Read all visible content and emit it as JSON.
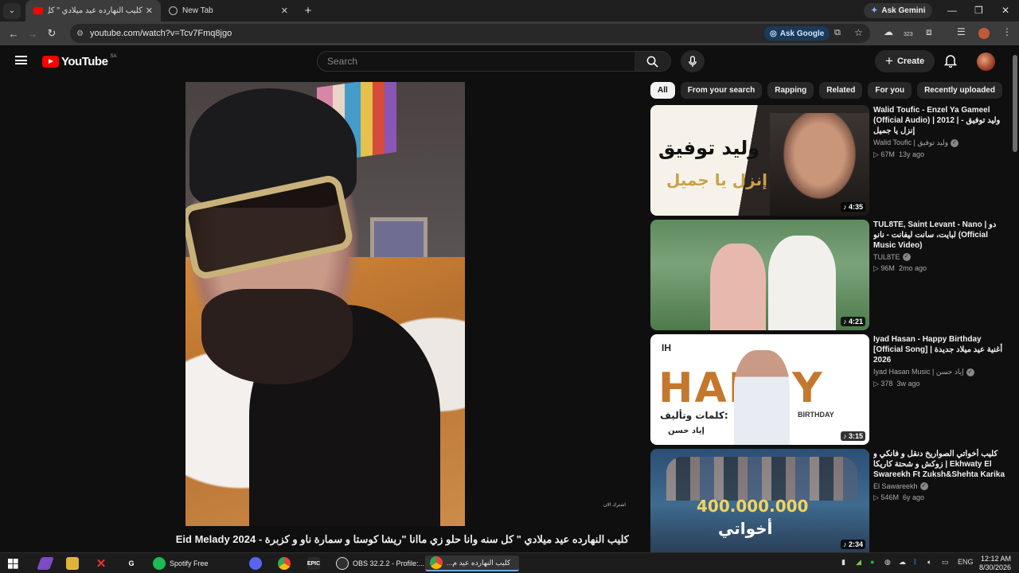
{
  "browser": {
    "tabs": [
      {
        "title": "كليب النهارده عيد ميلادي \" كل سنة",
        "active": true
      },
      {
        "title": "New Tab",
        "active": false
      }
    ],
    "ask_gemini": "Ask Gemini",
    "url": "youtube.com/watch?v=Tcv7Fmq8jgo",
    "ask_google": "Ask Google",
    "badge_count": "323"
  },
  "youtube": {
    "logo": "YouTube",
    "country": "SA",
    "search_placeholder": "Search",
    "create_label": "Create"
  },
  "video": {
    "title": "كليب النهارده عيد ميلادي \" كل سنه وانا حلو زي ماانا \"ريشا كوستا و سمارة ناو و كزبرة - Eid Melady 2024",
    "overlay_caption": "اشترك الان"
  },
  "chips": [
    "All",
    "From your search",
    "Rapping",
    "Related",
    "For you",
    "Recently uploaded"
  ],
  "recommendations": [
    {
      "title": "Walid Toufic - Enzel Ya Gameel (Official Audio) | 2012 | وليد توفيق - إنزل يا جميل",
      "channel": "Walid Toufic | وليد توفيق",
      "verified": true,
      "views": "67M",
      "age": "13y ago",
      "duration": "4:35",
      "thumb_text": [
        "وليد توفيق",
        "إنزل يا جميل"
      ]
    },
    {
      "title": "TUL8TE, Saint Levant - Nano | دو لبايت، سانت ليفانت - نانو (Official Music Video)",
      "channel": "TUL8TE",
      "verified": true,
      "views": "96M",
      "age": "2mo ago",
      "duration": "4:21"
    },
    {
      "title": "Iyad Hasan - Happy Birthday [Official Song] | أغنية عيد ميلاد جديدة 2026",
      "channel": "Iyad Hasan Music | إياد حسن",
      "verified": true,
      "views": "378",
      "age": "3w ago",
      "duration": "3:15",
      "thumb_text": [
        "IH",
        "HAPPY",
        "BIRTHDAY",
        "كلمات وتأليف:",
        "إياد حسن"
      ]
    },
    {
      "title": "كليب أخواتي الصواريخ دنقل و فانكي و زوكش و شحتة كاريكا | Ekhwaty El Swareekh Ft Zuksh&Shehta Karika",
      "channel": "El Sawareekh",
      "verified": true,
      "views": "546M",
      "age": "6y ago",
      "duration": "2:34",
      "thumb_text": [
        "400.000.000",
        "أخواتي"
      ]
    }
  ],
  "taskbar": {
    "apps": [
      {
        "name": "Spotify Free",
        "color": "#1db954"
      },
      {
        "name": "OBS 32.2.2 - Profile:...",
        "color": "#302e31"
      },
      {
        "name": "كليب النهارده عيد م...",
        "color": "#4285f4",
        "active": true
      }
    ],
    "language": "ENG",
    "time": "12:12 AM",
    "date": "8/30/2026"
  }
}
